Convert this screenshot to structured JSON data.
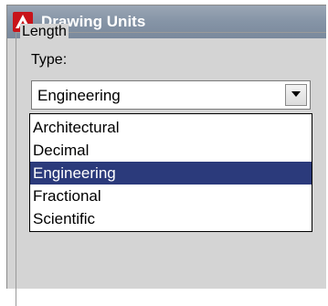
{
  "window": {
    "title": "Drawing Units",
    "icon": "autocad-logo-icon",
    "accent_color": "#c8141a",
    "titlebar_color": "#8594a6"
  },
  "length_group": {
    "label": "Length",
    "type_label": "Type:",
    "type_select": {
      "selected": "Engineering",
      "options": [
        "Architectural",
        "Decimal",
        "Engineering",
        "Fractional",
        "Scientific"
      ],
      "highlighted_index": 2,
      "highlight_color": "#2b3a7b"
    }
  }
}
